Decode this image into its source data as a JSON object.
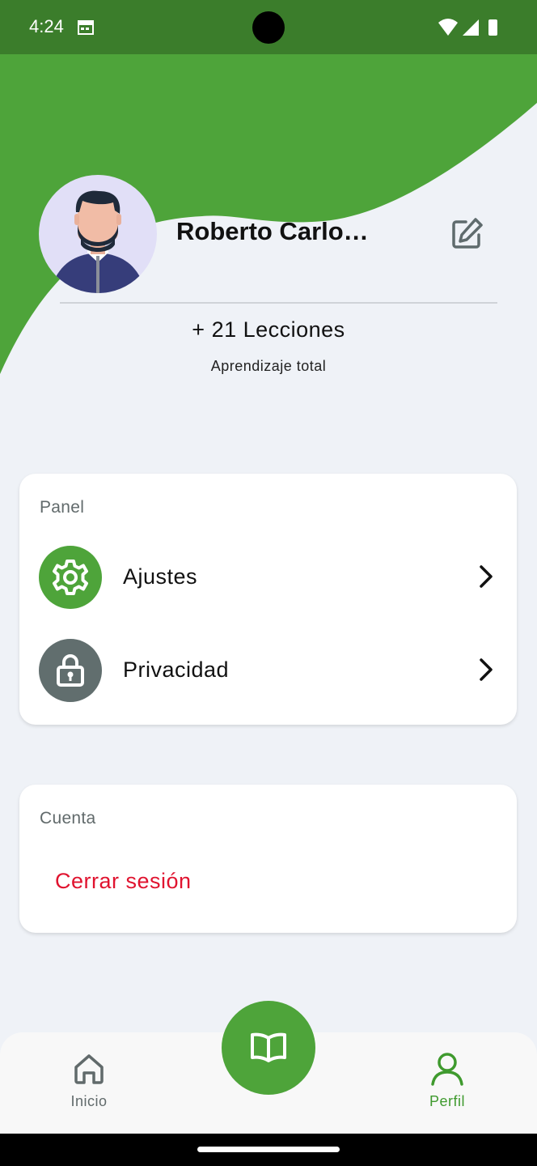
{
  "status_bar": {
    "time": "4:24"
  },
  "profile": {
    "name": "Roberto Carlo…",
    "lessons": "+ 21 Lecciones",
    "lessons_subtitle": "Aprendizaje total"
  },
  "panel": {
    "title": "Panel",
    "items": [
      {
        "label": "Ajustes",
        "icon": "gear-icon",
        "color": "#4ea43a"
      },
      {
        "label": "Privacidad",
        "icon": "lock-icon",
        "color": "#616e6e"
      }
    ]
  },
  "account": {
    "title": "Cuenta",
    "logout_label": "Cerrar sesión",
    "logout_color": "#e0132f"
  },
  "bottom_nav": {
    "items": [
      {
        "label": "Inicio",
        "icon": "home-icon",
        "active": false
      },
      {
        "label": "Perfil",
        "icon": "person-icon",
        "active": true
      }
    ],
    "center_action_icon": "book-icon",
    "active_color": "#3f9a2e",
    "inactive_color": "#616a6b"
  },
  "colors": {
    "brand_green": "#4ea43a",
    "status_bar": "#3b7d2b",
    "background": "#eff2f7"
  }
}
